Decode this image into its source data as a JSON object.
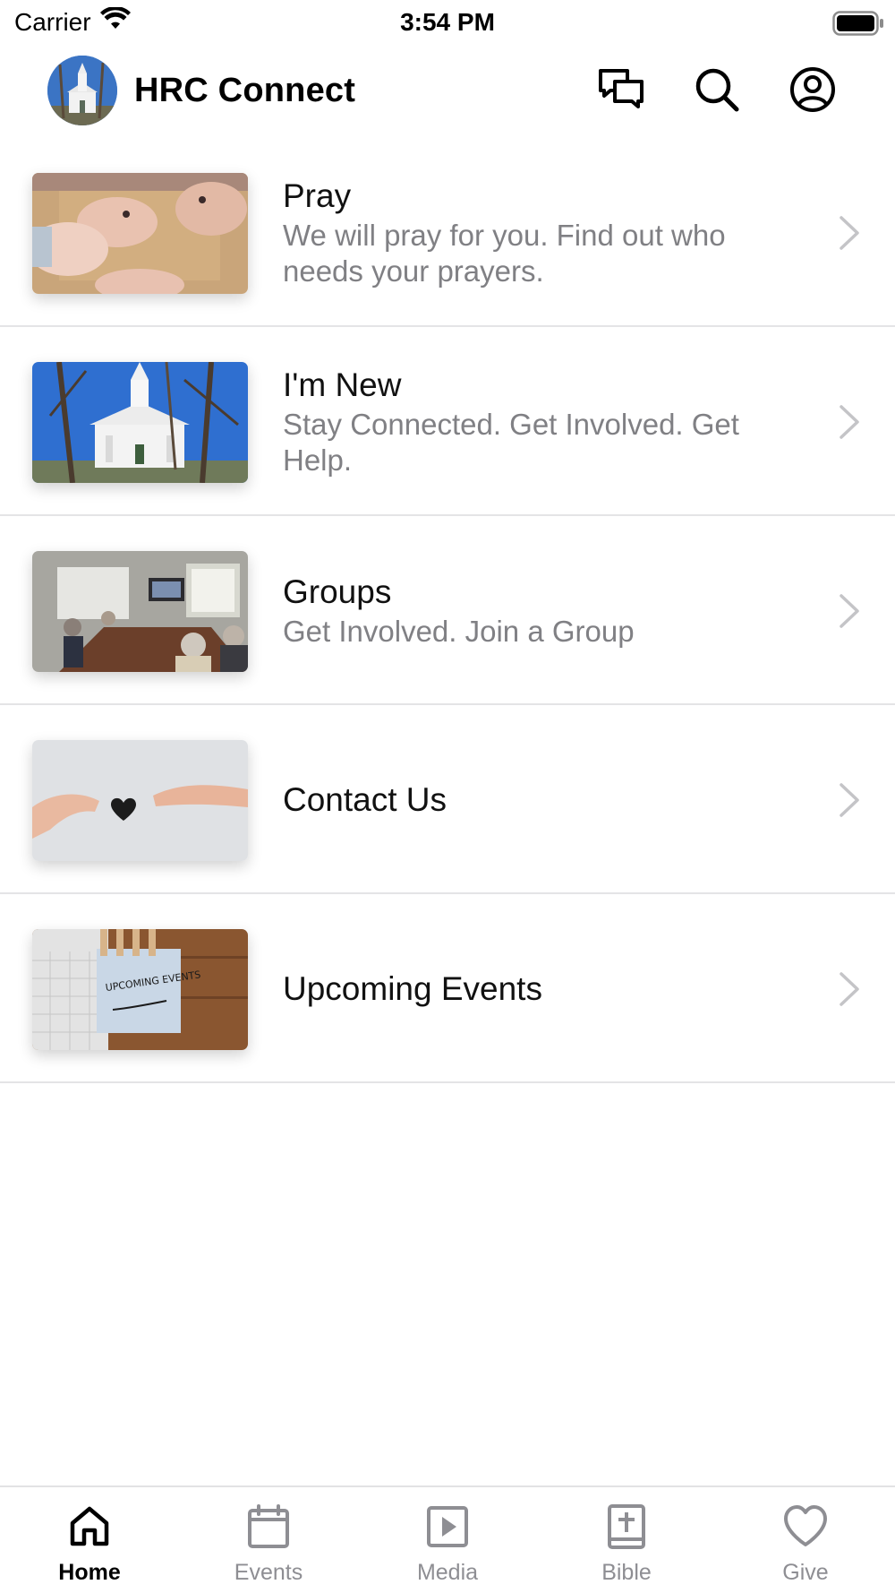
{
  "status_bar": {
    "carrier": "Carrier",
    "time": "3:54 PM"
  },
  "header": {
    "title": "HRC Connect",
    "icons": [
      "messages-icon",
      "search-icon",
      "profile-icon"
    ]
  },
  "menu": {
    "items": [
      {
        "title": "Pray",
        "subtitle": "We will pray for you. Find out who needs your prayers."
      },
      {
        "title": "I'm New",
        "subtitle": "Stay Connected.  Get Involved. Get Help."
      },
      {
        "title": "Groups",
        "subtitle": "Get Involved.  Join a Group"
      },
      {
        "title": "Contact Us",
        "subtitle": ""
      },
      {
        "title": "Upcoming Events",
        "subtitle": "",
        "thumbnail_text": "UPCOMING EVENTS"
      }
    ]
  },
  "tab_bar": {
    "active": "Home",
    "tabs": [
      {
        "label": "Home",
        "icon": "home-icon"
      },
      {
        "label": "Events",
        "icon": "calendar-icon"
      },
      {
        "label": "Media",
        "icon": "play-icon"
      },
      {
        "label": "Bible",
        "icon": "bible-icon"
      },
      {
        "label": "Give",
        "icon": "heart-icon"
      }
    ]
  },
  "colors": {
    "text_primary": "#111111",
    "text_secondary": "#808084",
    "tab_inactive": "#8e8e93",
    "divider": "#e4e4e6"
  }
}
